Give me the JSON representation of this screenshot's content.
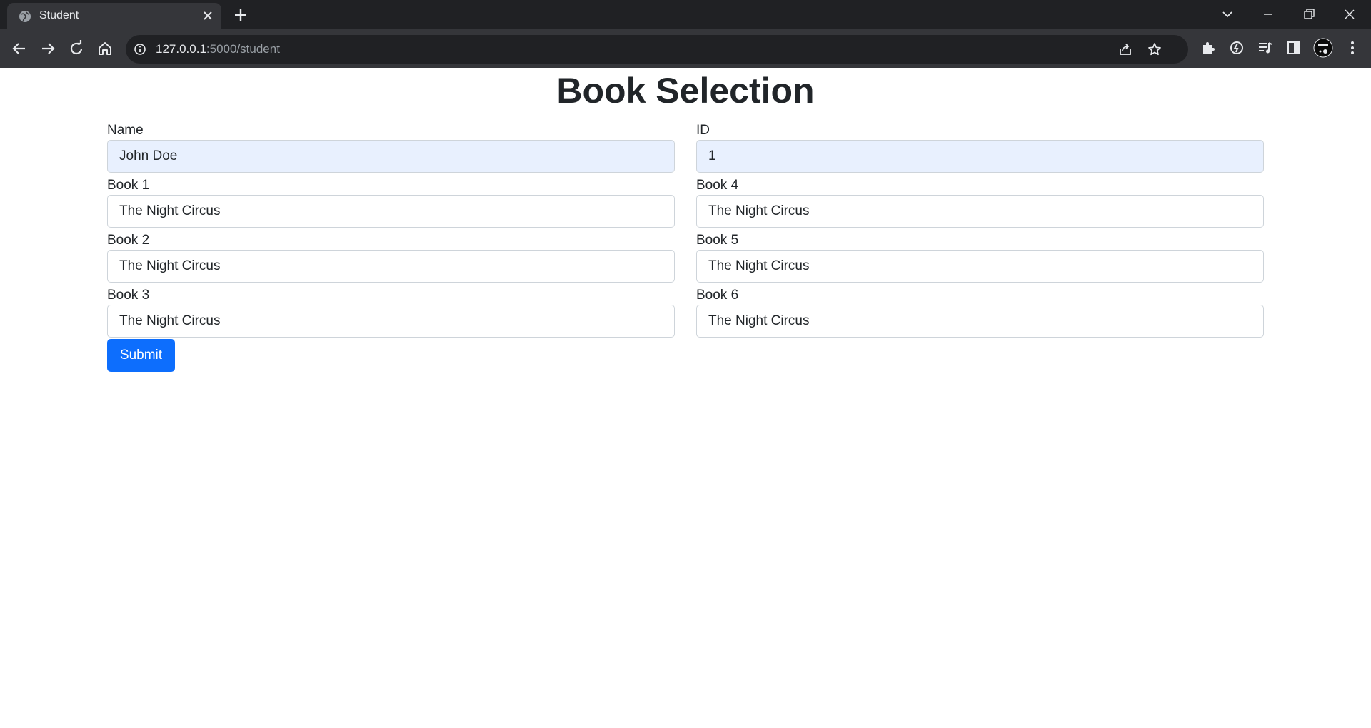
{
  "browser": {
    "tab_title": "Student",
    "url_host": "127.0.0.1",
    "url_rest": ":5000/student",
    "icons": [
      "globe-icon",
      "close-icon",
      "plus-icon",
      "tab-search-icon",
      "minimize-icon",
      "restore-icon",
      "window-close-icon",
      "back-icon",
      "forward-icon",
      "reload-icon",
      "home-icon",
      "info-icon",
      "share-icon",
      "star-icon",
      "extensions-icon",
      "extension-icon",
      "reading-list-icon",
      "side-panel-icon",
      "profile-avatar",
      "menu-icon"
    ]
  },
  "page": {
    "title": "Book Selection",
    "fields": {
      "name": {
        "label": "Name",
        "value": "John Doe"
      },
      "id": {
        "label": "ID",
        "value": "1"
      },
      "book1": {
        "label": "Book 1",
        "value": "The Night Circus"
      },
      "book2": {
        "label": "Book 2",
        "value": "The Night Circus"
      },
      "book3": {
        "label": "Book 3",
        "value": "The Night Circus"
      },
      "book4": {
        "label": "Book 4",
        "value": "The Night Circus"
      },
      "book5": {
        "label": "Book 5",
        "value": "The Night Circus"
      },
      "book6": {
        "label": "Book 6",
        "value": "The Night Circus"
      }
    },
    "submit_label": "Submit"
  },
  "colors": {
    "primary": "#0d6efd",
    "autofill": "#e8f0fe",
    "chrome_dark": "#202124",
    "chrome_toolbar": "#35363a"
  }
}
